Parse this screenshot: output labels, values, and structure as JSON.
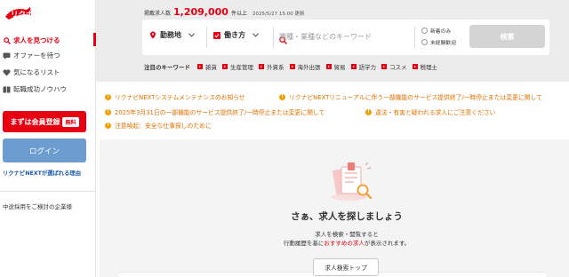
{
  "logo": {
    "text": "リクナビNEXT",
    "color": "#e60012"
  },
  "sidebar": {
    "items": [
      {
        "label": "求人を見つける",
        "icon": "search-icon",
        "active": true
      },
      {
        "label": "オファーを待つ",
        "icon": "message-icon",
        "active": false
      },
      {
        "label": "気になるリスト",
        "icon": "heart-icon",
        "active": false
      },
      {
        "label": "転職成功ノウハウ",
        "icon": "book-icon",
        "active": false
      }
    ],
    "register_label": "まずは会員登録",
    "register_badge": "無料",
    "login_label": "ログイン",
    "reason_link": "リクナビNEXTが選ばれる理由",
    "company_link": "中途採用をご検討の企業様"
  },
  "header": {
    "count_label": "掲載求人数",
    "count_value": "1,209,000",
    "count_unit": "件以上",
    "count_date": "2025/5/27 15:00 更新",
    "location_label": "勤務地",
    "style_label": "働き方",
    "keyword_placeholder": "職種・業種などのキーワード",
    "check_new": "新着のみ",
    "check_inexperienced": "未経験歓迎",
    "search_button": "検索",
    "keywords_title": "注目のキーワード",
    "keywords": [
      "雑貨",
      "生産管理",
      "外資系",
      "海外出張",
      "貿易",
      "語学力",
      "コスメ",
      "税理士"
    ]
  },
  "notices": [
    "リクナビNEXTシステムメンテナンスのお知らせ",
    "リクナビNEXTリニューアルに伴う一部機能のサービス提供終了/一時停止または変更に関して",
    "2025年3月31日の一部機能のサービス提供終了/一時停止または変更に関して",
    "違法・有害と疑われる求人にご注意ください",
    "注意喚起：安全な仕事探しのために"
  ],
  "empty_state": {
    "title": "さぁ、求人を探しましょう",
    "desc_line1": "求人を検索・閲覧すると",
    "desc_line2_pre": "行動履歴を基に",
    "desc_line2_highlight": "おすすめの求人",
    "desc_line2_post": "が表示されます。",
    "button": "求人検索トップ"
  },
  "colors": {
    "brand": "#e60012",
    "notice": "#e07000",
    "login": "#6d9cd0",
    "link": "#1a59b0"
  }
}
